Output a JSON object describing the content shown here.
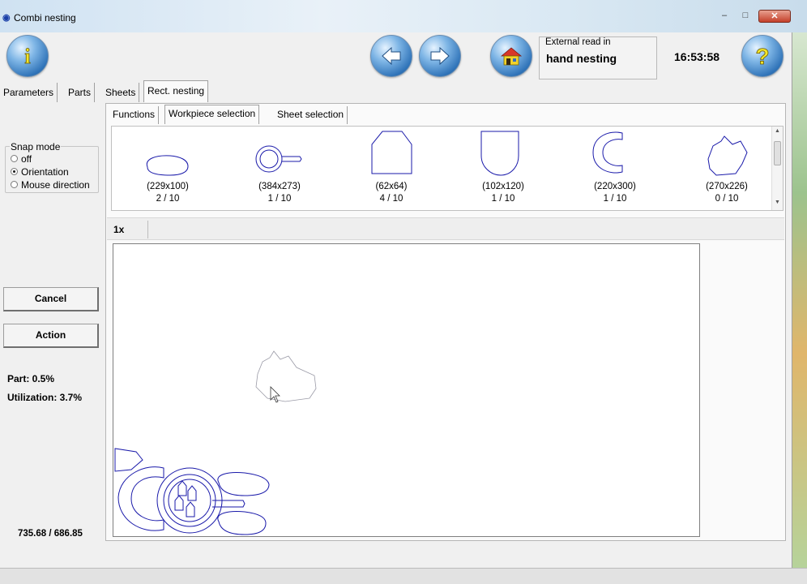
{
  "window": {
    "title": "Combi nesting",
    "minimize_glyph": "–",
    "maximize_glyph": "□",
    "close_glyph": "✕"
  },
  "toolbar": {
    "info_icon": "info-icon",
    "back_icon": "arrow-left-icon",
    "forward_icon": "arrow-right-icon",
    "home_icon": "home-icon",
    "help_icon": "help-icon",
    "external_label": "External read in",
    "external_value": "hand nesting",
    "time": "16:53:58"
  },
  "main_tabs": [
    {
      "label": "Parameters",
      "active": false
    },
    {
      "label": "Parts",
      "active": false
    },
    {
      "label": "Sheets",
      "active": false
    },
    {
      "label": "Rect. nesting",
      "active": true
    }
  ],
  "snap_mode": {
    "legend": "Snap mode",
    "options": [
      {
        "label": "off",
        "selected": false
      },
      {
        "label": "Orientation",
        "selected": true
      },
      {
        "label": "Mouse direction",
        "selected": false
      }
    ]
  },
  "actions": {
    "cancel_label": "Cancel",
    "action_label": "Action"
  },
  "stats": {
    "part": "Part: 0.5%",
    "utilization": "Utilization: 3.7%",
    "coords": "735.68 / 686.85"
  },
  "sub_tabs": [
    {
      "label": "Functions",
      "active": false
    },
    {
      "label": "Workpiece selection",
      "active": true
    },
    {
      "label": "Sheet selection",
      "active": false
    }
  ],
  "parts": [
    {
      "dims": "(229x100)",
      "count": "2 / 10",
      "shape": "teardrop"
    },
    {
      "dims": "(384x273)",
      "count": "1 / 10",
      "shape": "ring-handle"
    },
    {
      "dims": "(62x64)",
      "count": "4 / 10",
      "shape": "house"
    },
    {
      "dims": "(102x120)",
      "count": "1 / 10",
      "shape": "shield"
    },
    {
      "dims": "(220x300)",
      "count": "1 / 10",
      "shape": "c-shape"
    },
    {
      "dims": "(270x226)",
      "count": "0 / 10",
      "shape": "cloud"
    }
  ],
  "zoom": "1x",
  "colors": {
    "part_stroke": "#1a1aaa",
    "button_blue": "#2f73b8"
  }
}
